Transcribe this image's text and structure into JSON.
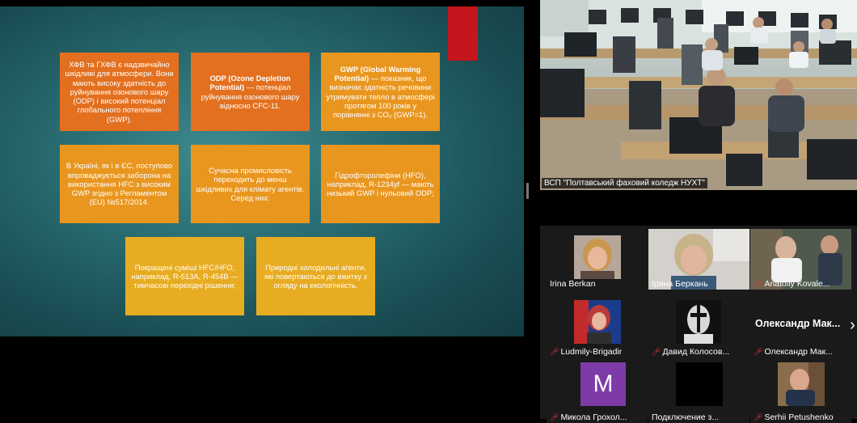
{
  "slide": {
    "boxes": [
      {
        "id": "hfc-hchfc",
        "parts": [
          {
            "t": "ХФВ та ГХФВ є надзвичайно шкідливі для атмосфери. Вони мають високу здатність до руйнування озонового шару (ODP) і високий потенціал глобального потепління  (GWP).",
            "b": false
          }
        ]
      },
      {
        "id": "odp",
        "parts": [
          {
            "t": "ODP (Ozone Depletion Potential)",
            "b": true
          },
          {
            "t": " — потенціал руйнування озонового шару відносно CFC-11.",
            "b": false
          }
        ]
      },
      {
        "id": "gwp",
        "parts": [
          {
            "t": "GWP (Global Warming Potential)",
            "b": true
          },
          {
            "t": " — показник, що визначає здатність речовини утримувати тепло в атмосфері протягом 100 років у порівнянні з CO₂ (GWP=1).",
            "b": false
          }
        ]
      },
      {
        "id": "ukraine-eu",
        "parts": [
          {
            "t": "В Україні, як і в ЄС, поступово впроваджується заборона на використання HFC з високим GWP згідно з Регламентом (EU) №517/2014.",
            "b": false
          }
        ]
      },
      {
        "id": "modern-industry",
        "parts": [
          {
            "t": "Сучасна промисловість переходить до менш шкідливих для клімату агентів. Серед них:",
            "b": false
          }
        ]
      },
      {
        "id": "hfo",
        "parts": [
          {
            "t": "Гідрофторолефіни (HFO), наприклад, R-1234yf — мають низький GWP і нульовий ODP;",
            "b": false
          }
        ]
      },
      {
        "id": "blends",
        "parts": [
          {
            "t": "Покращені суміші HFC/HFO, наприклад, R-513A, R-454B — тимчасові перехідні рішення;",
            "b": false
          }
        ]
      },
      {
        "id": "natural",
        "parts": [
          {
            "t": "Природні холодильні агенти, які повертаються до вжитку з огляду на екологічність.",
            "b": false
          }
        ]
      }
    ]
  },
  "main_video": {
    "label": "ВСП \"Полтавський фаховий коледж НУХТ\""
  },
  "participants": [
    {
      "name": "Irina Berkan",
      "muted": false,
      "media": "video"
    },
    {
      "name": "Ірина Беркань",
      "muted": false,
      "media": "video"
    },
    {
      "name": "Anatoliy Kovale...",
      "muted": true,
      "media": "video"
    },
    {
      "name": "Ludmily-Brigadir",
      "muted": true,
      "media": "video"
    },
    {
      "name": "Давид Колосов...",
      "muted": true,
      "media": "video"
    },
    {
      "name": "Олександр Мак...",
      "muted": true,
      "media": "text",
      "big": "Олександр  Мак..."
    },
    {
      "name": "Микола Грохол...",
      "muted": true,
      "media": "avatar",
      "initial": "M"
    },
    {
      "name": "Подключение з...",
      "muted": false,
      "media": "black"
    },
    {
      "name": "Serhii Petushenko",
      "muted": true,
      "media": "video"
    }
  ],
  "icons": {
    "mic_muted": "mic-muted-icon",
    "next_page": "chevron-right-icon"
  },
  "colors": {
    "slide_bg": "#2a6e73",
    "box_orange": "#e3701f",
    "box_amber": "#e9961f",
    "box_yellow": "#e8ac22",
    "accent_red": "#c4161c",
    "mic_red": "#e5393f",
    "avatar_purple": "#7e3ba8"
  }
}
